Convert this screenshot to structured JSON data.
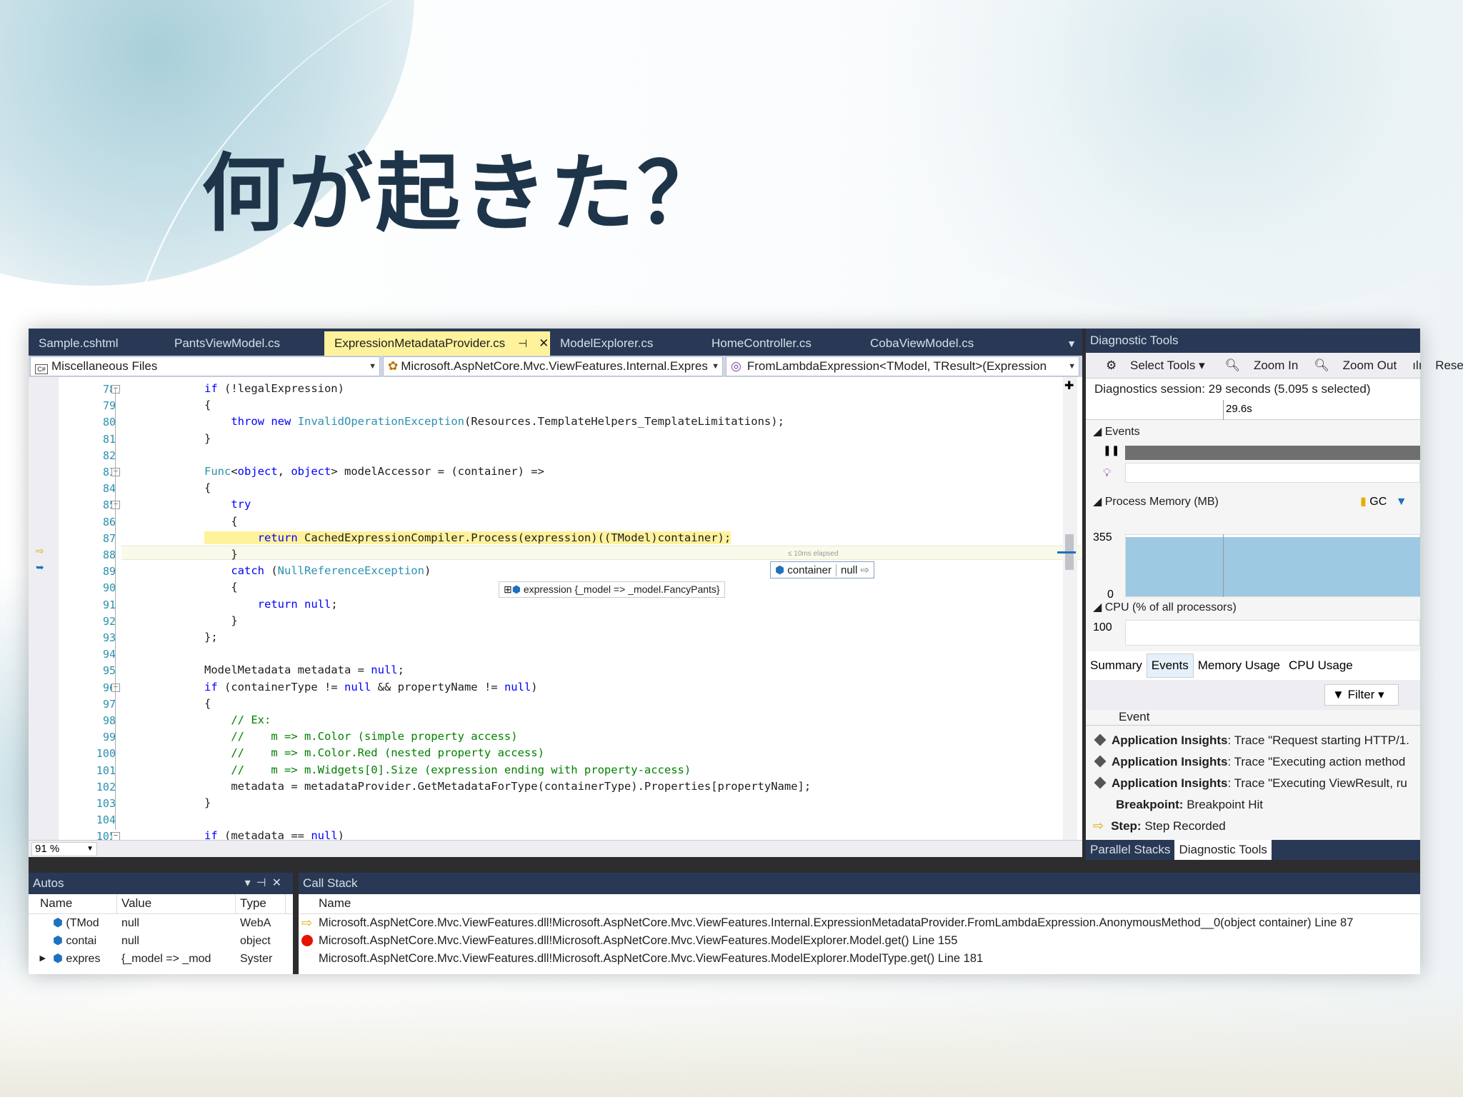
{
  "slide_title": "何が起きた？",
  "editor": {
    "tabs": [
      "Sample.cshtml",
      "PantsViewModel.cs",
      "ExpressionMetadataProvider.cs",
      "ModelExplorer.cs",
      "HomeController.cs",
      "CobaViewModel.cs"
    ],
    "active_tab_index": 2,
    "nav": {
      "project": "Miscellaneous Files",
      "type": "Microsoft.AspNetCore.Mvc.ViewFeatures.Internal.Expres",
      "member": "FromLambdaExpression<TModel, TResult>(Expression"
    },
    "line_numbers": [
      "78",
      "79",
      "80",
      "81",
      "82",
      "83",
      "84",
      "85",
      "86",
      "87",
      "88",
      "89",
      "90",
      "91",
      "92",
      "93",
      "94",
      "95",
      "96",
      "97",
      "98",
      "99",
      "100",
      "101",
      "102",
      "103",
      "104",
      "105"
    ],
    "lines": [
      "if (!legalExpression)",
      "{",
      "    throw new InvalidOperationException(Resources.TemplateHelpers_TemplateLimitations);",
      "}",
      "",
      "Func<object, object> modelAccessor = (container) =>",
      "{",
      "    try",
      "    {",
      "        return CachedExpressionCompiler.Process(expression)((TModel)container);",
      "    }",
      "    catch (NullReferenceException)",
      "    {",
      "        return null;",
      "    }",
      "};",
      "",
      "ModelMetadata metadata = null;",
      "if (containerType != null && propertyName != null)",
      "{",
      "    // Ex:",
      "    //    m => m.Color (simple property access)",
      "    //    m => m.Color.Red (nested property access)",
      "    //    m => m.Widgets[0].Size (expression ending with property-access)",
      "    metadata = metadataProvider.GetMetadataForType(containerType).Properties[propertyName];",
      "}",
      "",
      "if (metadata == null)"
    ],
    "elapsed_label": "≤ 10ms elapsed",
    "datatip_container": {
      "name": "container",
      "value": "null"
    },
    "datatip_expression": {
      "name": "expression",
      "value": "{_model => _model.FancyPants}"
    },
    "zoom": "91 %"
  },
  "diagnostics": {
    "title": "Diagnostic Tools",
    "toolbar": {
      "select_tools": "Select Tools",
      "zoom_in": "Zoom In",
      "zoom_out": "Zoom Out",
      "reset": "Rese"
    },
    "session": "Diagnostics session: 29 seconds (5.095 s selected)",
    "ruler_label": "29.6s",
    "events_label": "Events",
    "memory_label": "Process Memory (MB)",
    "gc_label": "GC",
    "mem_max": "355",
    "mem_min": "0",
    "cpu_label": "CPU (% of all processors)",
    "cpu_max": "100",
    "tabs": [
      "Summary",
      "Events",
      "Memory Usage",
      "CPU Usage"
    ],
    "active_tab_index": 1,
    "filter": "Filter",
    "event_column": "Event",
    "events": [
      {
        "bold": "Application Insights",
        "text": ": Trace \"Request starting HTTP/1."
      },
      {
        "bold": "Application Insights",
        "text": ": Trace \"Executing action method"
      },
      {
        "bold": "Application Insights",
        "text": ": Trace \"Executing ViewResult, ru"
      },
      {
        "bold": "Breakpoint:",
        "text": " Breakpoint Hit"
      },
      {
        "bold": "Step:",
        "text": " Step Recorded"
      }
    ],
    "bottom_tabs": [
      "Parallel Stacks",
      "Diagnostic Tools"
    ]
  },
  "autos": {
    "title": "Autos",
    "columns": [
      "Name",
      "Value",
      "Type"
    ],
    "rows": [
      {
        "name": "(TMod",
        "value": "null",
        "type": "WebA"
      },
      {
        "name": "contai",
        "value": "null",
        "type": "object"
      },
      {
        "name": "expres",
        "value": "{_model => _mod",
        "type": "Syster"
      }
    ]
  },
  "callstack": {
    "title": "Call Stack",
    "column": "Name",
    "rows": [
      "Microsoft.AspNetCore.Mvc.ViewFeatures.dll!Microsoft.AspNetCore.Mvc.ViewFeatures.Internal.ExpressionMetadataProvider.FromLambdaExpression.AnonymousMethod__0(object container) Line 87",
      "Microsoft.AspNetCore.Mvc.ViewFeatures.dll!Microsoft.AspNetCore.Mvc.ViewFeatures.ModelExplorer.Model.get() Line 155",
      "Microsoft.AspNetCore.Mvc.ViewFeatures.dll!Microsoft.AspNetCore.Mvc.ViewFeatures.ModelExplorer.ModelType.get() Line 181"
    ]
  },
  "colors": {
    "title": "#1e3549",
    "vs_chrome": "#293955",
    "active_tab": "#fff29d",
    "keyword": "#0000ff",
    "type": "#2b91af",
    "comment": "#008000"
  }
}
